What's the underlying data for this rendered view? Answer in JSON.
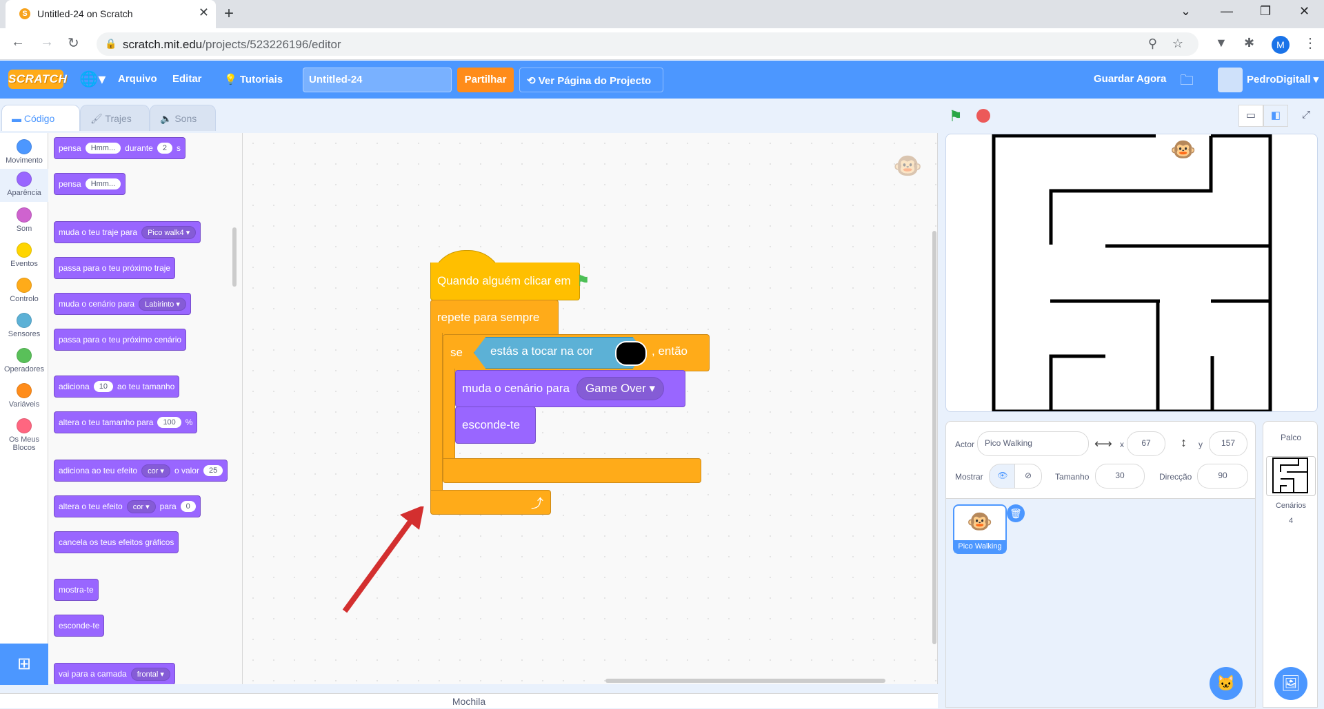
{
  "browser": {
    "tab_title": "Untitled-24 on Scratch",
    "url_host": "scratch.mit.edu",
    "url_path": "/projects/523226196/editor",
    "profile_initial": "M"
  },
  "menu": {
    "logo": "SCRATCH",
    "file": "Arquivo",
    "edit": "Editar",
    "tutorials": "Tutoriais",
    "project_title": "Untitled-24",
    "share": "Partilhar",
    "see_project_page": "Ver Página do Projecto",
    "save_now": "Guardar Agora",
    "username": "PedroDigitall"
  },
  "editor_tabs": {
    "code": "Código",
    "costumes": "Trajes",
    "sounds": "Sons"
  },
  "categories": [
    {
      "label": "Movimento",
      "color": "#4c97ff"
    },
    {
      "label": "Aparência",
      "color": "#9966ff"
    },
    {
      "label": "Som",
      "color": "#cf63cf"
    },
    {
      "label": "Eventos",
      "color": "#ffd500"
    },
    {
      "label": "Controlo",
      "color": "#ffab19"
    },
    {
      "label": "Sensores",
      "color": "#5cb1d6"
    },
    {
      "label": "Operadores",
      "color": "#59c059"
    },
    {
      "label": "Variáveis",
      "color": "#ff8c1a"
    },
    {
      "label": "Os Meus Blocos",
      "color": "#ff6680"
    }
  ],
  "palette": {
    "think_for": {
      "a": "pensa",
      "val": "Hmm...",
      "b": "durante",
      "secs": "2",
      "c": "s"
    },
    "think": {
      "a": "pensa",
      "val": "Hmm..."
    },
    "switch_costume": {
      "a": "muda o teu traje para",
      "val": "Pico walk4"
    },
    "next_costume": "passa para o teu próximo traje",
    "switch_backdrop": {
      "a": "muda o cenário para",
      "val": "Labirinto"
    },
    "next_backdrop": "passa para o teu próximo cenário",
    "change_size": {
      "a": "adiciona",
      "val": "10",
      "b": "ao teu tamanho"
    },
    "set_size": {
      "a": "altera o teu tamanho para",
      "val": "100",
      "b": "%"
    },
    "change_effect": {
      "a": "adiciona ao teu efeito",
      "effect": "cor",
      "b": "o valor",
      "val": "25"
    },
    "set_effect": {
      "a": "altera o teu efeito",
      "effect": "cor",
      "b": "para",
      "val": "0"
    },
    "clear_effects": "cancela os teus efeitos gráficos",
    "show": "mostra-te",
    "hide": "esconde-te",
    "go_to_layer": {
      "a": "vai para a camada",
      "val": "frontal"
    }
  },
  "script": {
    "hat": "Quando alguém clicar em",
    "forever": "repete para sempre",
    "if_label": "se",
    "then_label": ", então",
    "touching_color": "estás a tocar na cor",
    "switch_backdrop": "muda o cenário para",
    "backdrop_value": "Game Over",
    "hide": "esconde-te"
  },
  "sprite_info": {
    "actor_label": "Actor",
    "actor_name": "Pico Walking",
    "x_label": "x",
    "x": "67",
    "y_label": "y",
    "y": "157",
    "show_label": "Mostrar",
    "size_label": "Tamanho",
    "size": "30",
    "direction_label": "Direcção",
    "direction": "90"
  },
  "sprite_list": {
    "sprite_name": "Pico Walking"
  },
  "stage_panel": {
    "title": "Palco",
    "backdrops_label": "Cenários",
    "backdrops_count": "4"
  },
  "backpack": "Mochila",
  "colors": {
    "scratch_blue": "#4c97ff",
    "looks": "#9966ff",
    "events": "#ffbf00",
    "control": "#ffab19",
    "sensing": "#5cb1d6",
    "share_orange": "#ff8c1a"
  }
}
